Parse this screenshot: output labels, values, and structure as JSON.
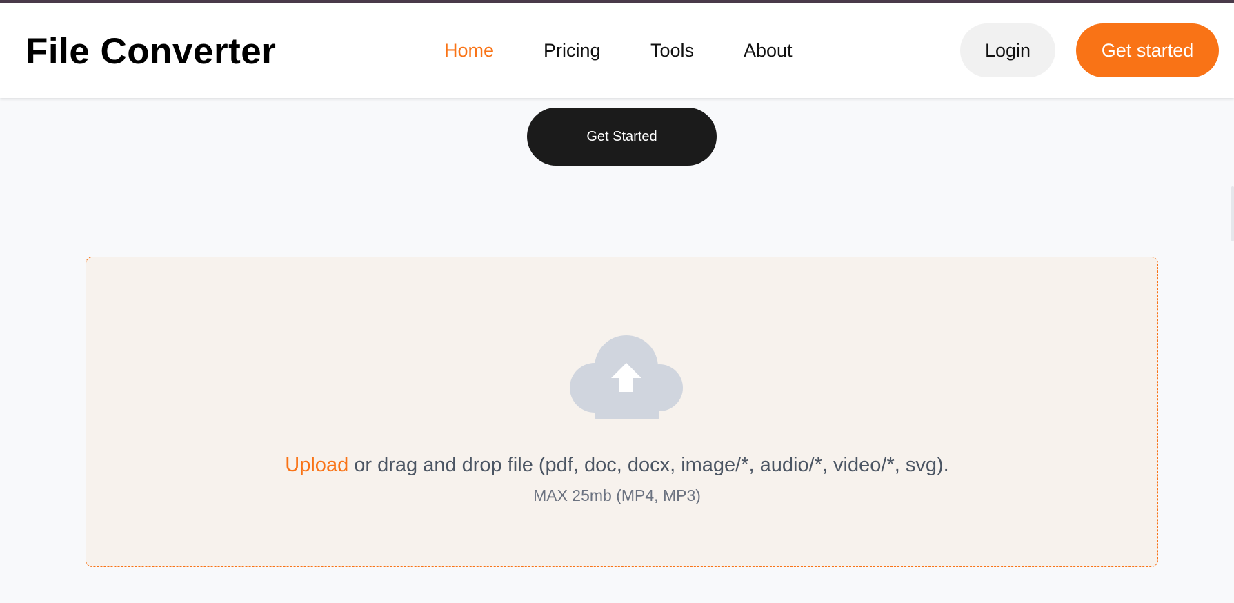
{
  "header": {
    "logo": "File Converter",
    "nav": [
      {
        "label": "Home",
        "active": true
      },
      {
        "label": "Pricing",
        "active": false
      },
      {
        "label": "Tools",
        "active": false
      },
      {
        "label": "About",
        "active": false
      }
    ],
    "login_label": "Login",
    "cta_label": "Get started"
  },
  "hero": {
    "button_label": "Get Started"
  },
  "dropzone": {
    "icon": "cloud-upload-icon",
    "upload_link": "Upload",
    "text": " or drag and drop file (pdf, doc, docx, image/*, audio/*, video/*, svg).",
    "max_note": "MAX 25mb (MP4, MP3)"
  },
  "colors": {
    "accent": "#f97316",
    "dark_button": "#1b1b1b",
    "dropzone_bg": "#f7f2ed",
    "icon_gray": "#d0d5de"
  }
}
